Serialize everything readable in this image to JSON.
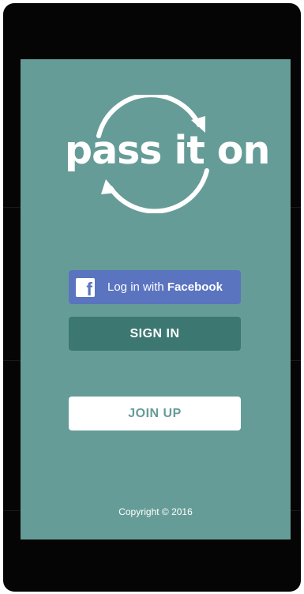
{
  "logo": {
    "text": "pass it on"
  },
  "buttons": {
    "facebook_prefix": "Log in with ",
    "facebook_brand": "Facebook",
    "facebook_icon_glyph": "f",
    "sign_in": "SIGN IN",
    "join_up": "JOIN UP"
  },
  "footer": {
    "copyright": "Copyright © 2016"
  },
  "colors": {
    "screen_bg": "#669c98",
    "facebook_blue": "#5a74c0",
    "sign_in_bg": "#3c7772",
    "join_up_bg": "#ffffff",
    "device_frame": "#050505"
  },
  "icons": {
    "facebook": "facebook-icon",
    "logo_arrows": "recycle-arrows-icon"
  }
}
